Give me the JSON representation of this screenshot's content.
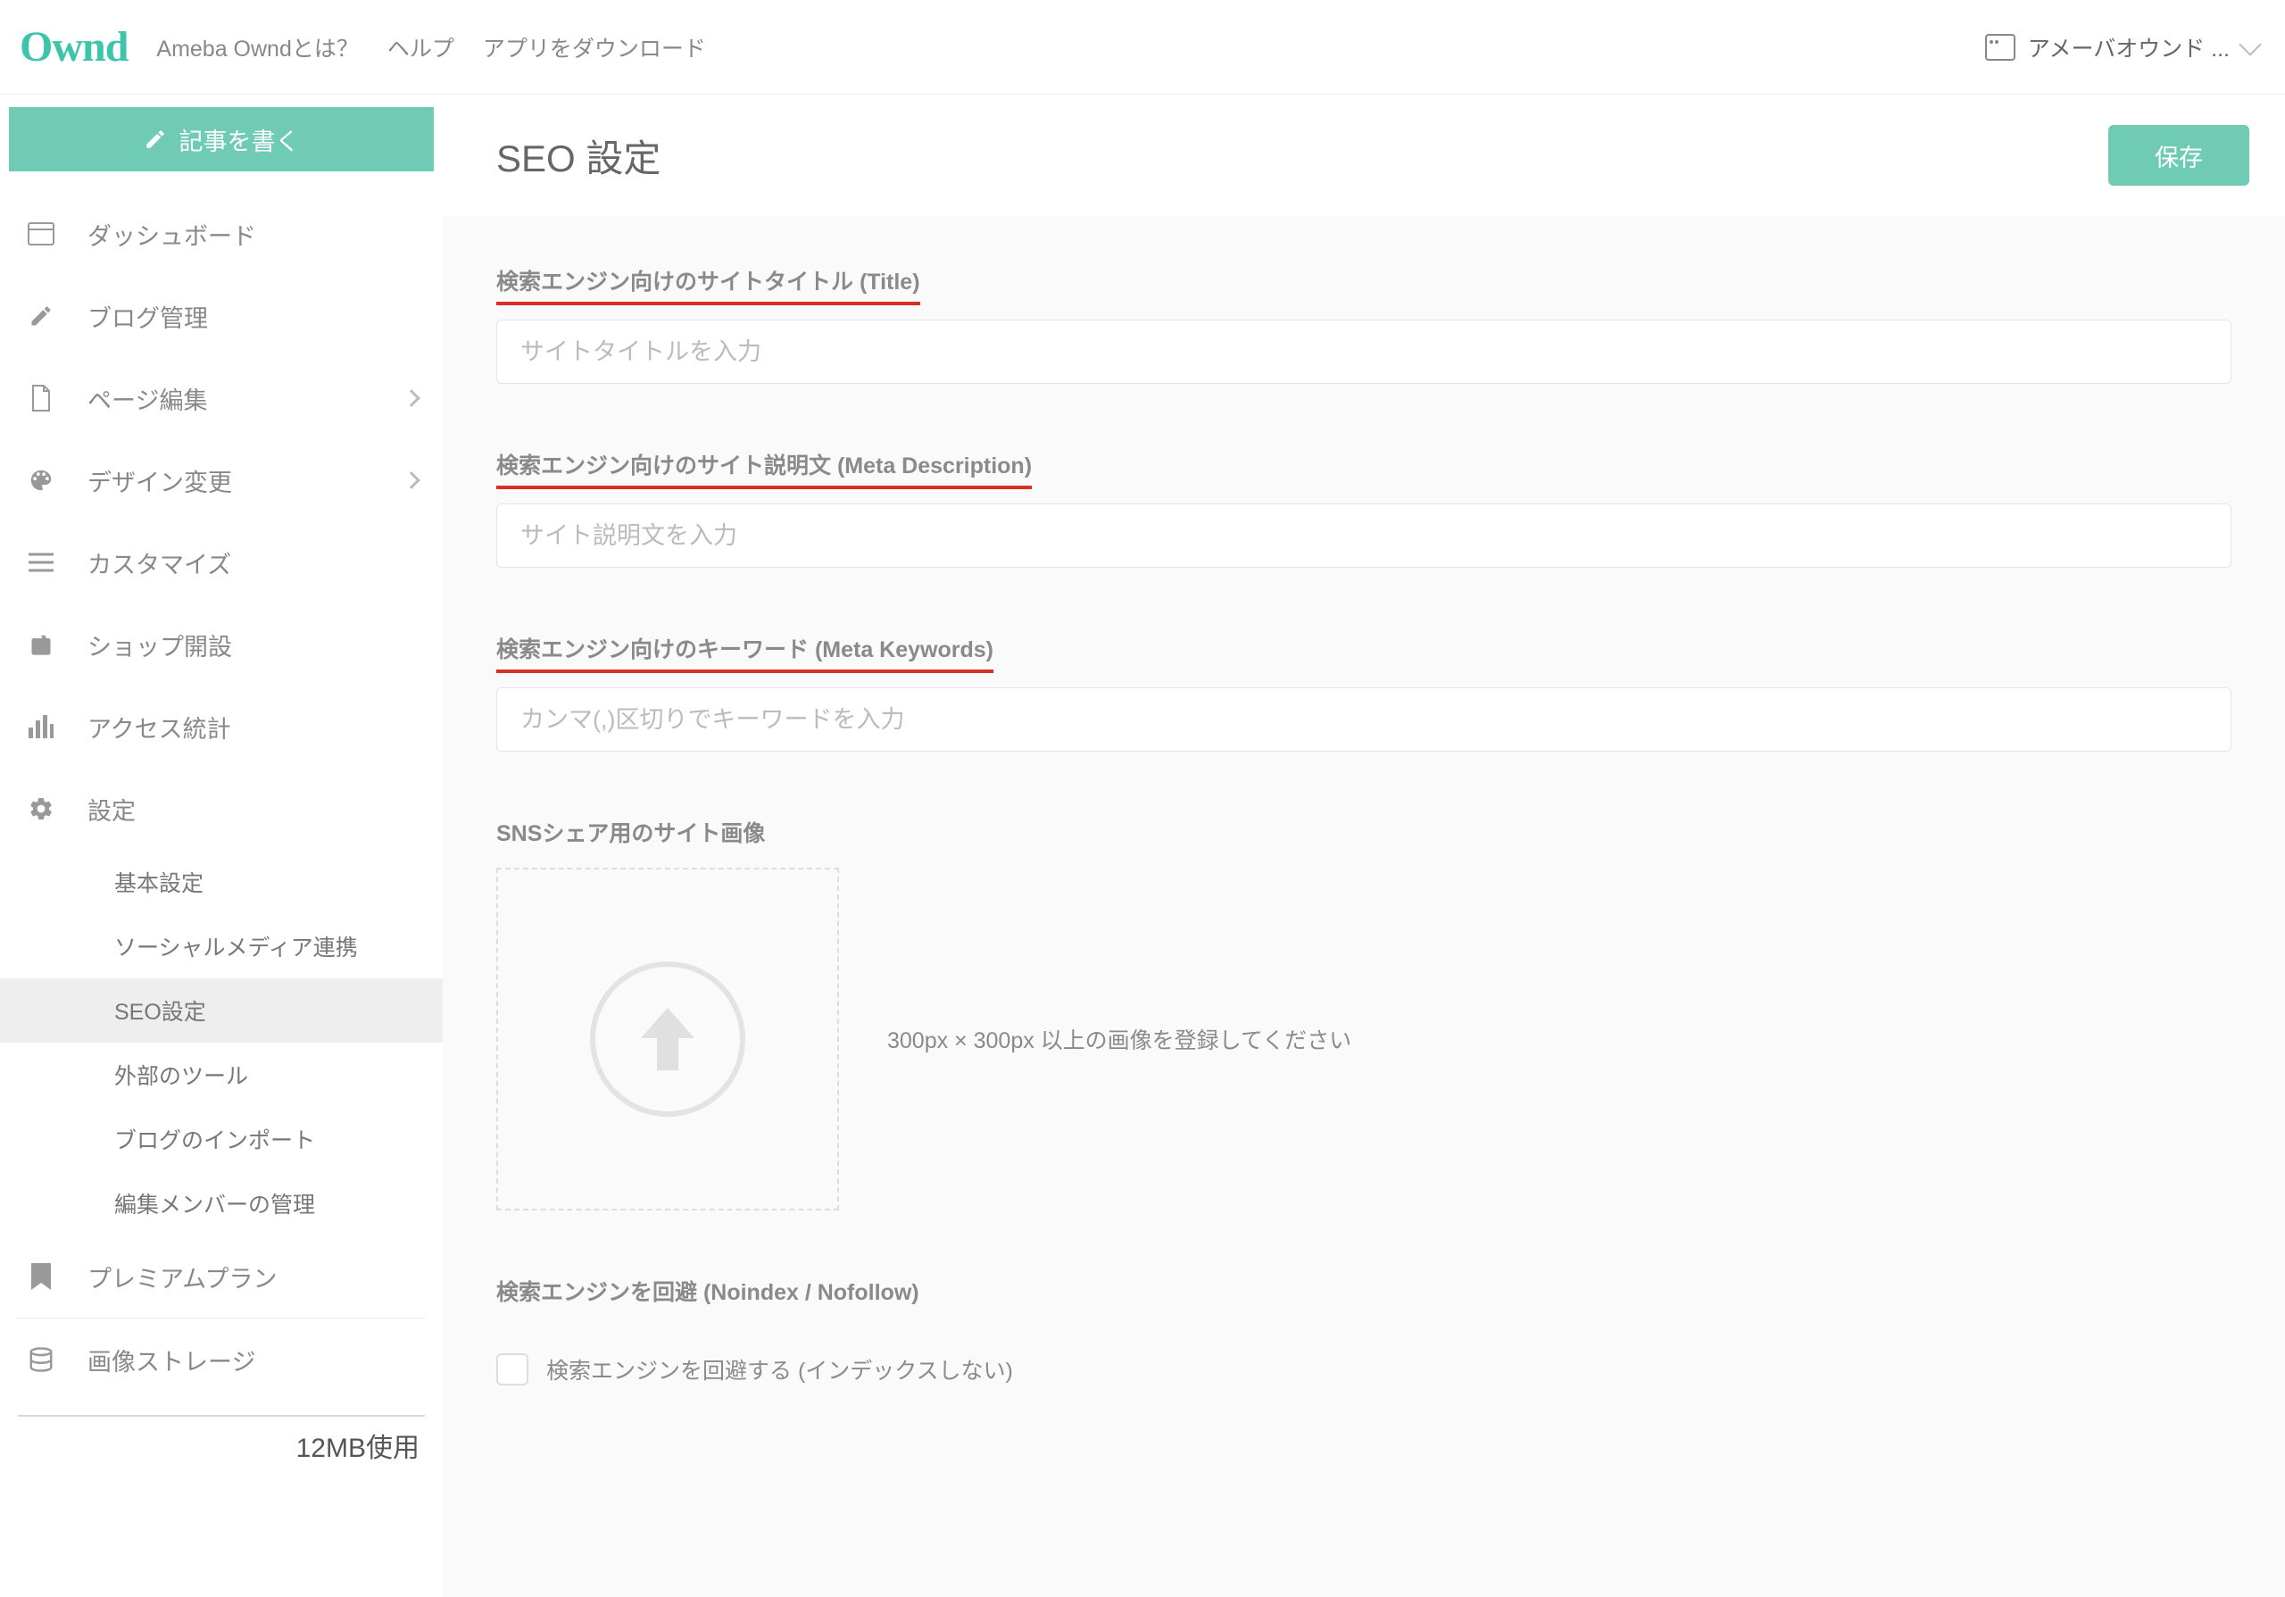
{
  "header": {
    "logo": "Ownd",
    "nav": {
      "about": "Ameba Owndとは？",
      "help": "ヘルプ",
      "download": "アプリをダウンロード"
    },
    "site_selector": "アメーバオウンド ..."
  },
  "sidebar": {
    "write_button": "記事を書く",
    "items": {
      "dashboard": "ダッシュボード",
      "blog": "ブログ管理",
      "pages": "ページ編集",
      "design": "デザイン変更",
      "customize": "カスタマイズ",
      "shop": "ショップ開設",
      "stats": "アクセス統計",
      "settings": "設定",
      "premium": "プレミアムプラン",
      "storage": "画像ストレージ"
    },
    "settings_sub": {
      "basic": "基本設定",
      "social": "ソーシャルメディア連携",
      "seo": "SEO設定",
      "external": "外部のツール",
      "import": "ブログのインポート",
      "members": "編集メンバーの管理"
    },
    "storage_usage": "12MB使用"
  },
  "main": {
    "title": "SEO 設定",
    "save": "保存",
    "fields": {
      "title_label": "検索エンジン向けのサイトタイトル (Title)",
      "title_placeholder": "サイトタイトルを入力",
      "desc_label": "検索エンジン向けのサイト説明文 (Meta Description)",
      "desc_placeholder": "サイト説明文を入力",
      "keywords_label": "検索エンジン向けのキーワード (Meta Keywords)",
      "keywords_placeholder": "カンマ(,)区切りでキーワードを入力",
      "sns_label": "SNSシェア用のサイト画像",
      "sns_hint": "300px × 300px 以上の画像を登録してください",
      "noindex_label": "検索エンジンを回避 (Noindex / Nofollow)",
      "noindex_checkbox": "検索エンジンを回避する (インデックスしない)"
    }
  }
}
